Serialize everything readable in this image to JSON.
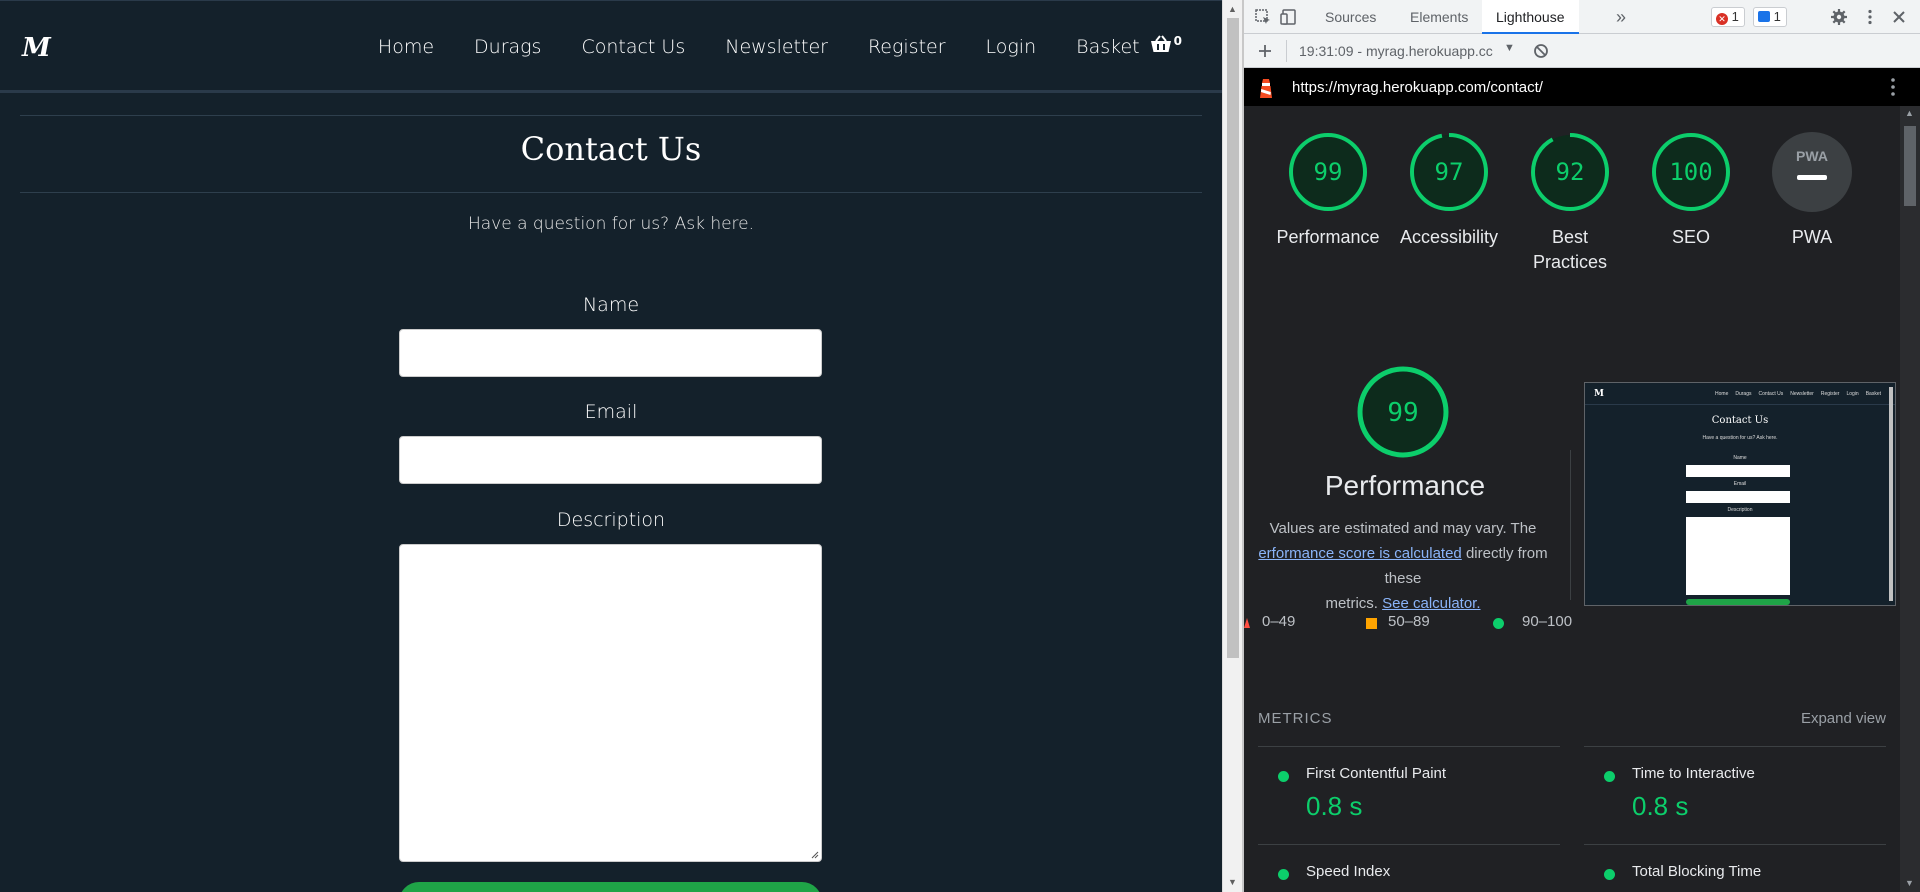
{
  "site": {
    "logo": "M",
    "nav": [
      "Home",
      "Durags",
      "Contact Us",
      "Newsletter",
      "Register",
      "Login",
      "Basket"
    ],
    "basket_count": "0",
    "title": "Contact Us",
    "subtitle": "Have a question for us? Ask here.",
    "fields": {
      "name_label": "Name",
      "email_label": "Email",
      "description_label": "Description"
    }
  },
  "devtools": {
    "tabs": [
      "Sources",
      "Elements",
      "Lighthouse"
    ],
    "active_tab": "Lighthouse",
    "more_tabs_glyph": "»",
    "error_count": "1",
    "message_count": "1",
    "report_selector": "19:31:09 - myrag.herokuapp.cc",
    "url": "https://myrag.herokuapp.com/contact/",
    "scores": [
      {
        "label": "Performance",
        "value": 99
      },
      {
        "label": "Accessibility",
        "value": 97
      },
      {
        "label": "Best Practices",
        "value": 92
      },
      {
        "label": "SEO",
        "value": 100
      },
      {
        "label": "PWA",
        "value": "PWA"
      }
    ],
    "performance": {
      "score": 99,
      "title": "Performance",
      "desc_line1": "Values are estimated and may vary. The",
      "link1": "erformance score is calculated",
      "desc_line2_rest": " directly from these",
      "desc_line3": "metrics. ",
      "link2": "See calculator.",
      "legend": [
        "0–49",
        "50–89",
        "90–100"
      ]
    },
    "thumbnail": {
      "nav": [
        "Home",
        "Durags",
        "Contact Us",
        "Newsletter",
        "Register",
        "Login",
        "Basket"
      ],
      "title": "Contact Us",
      "subtitle": "Have a question for us? Ask here.",
      "labels": [
        "Name",
        "Email",
        "Description"
      ]
    },
    "metrics_heading": "METRICS",
    "expand_label": "Expand view",
    "metrics": [
      {
        "name": "First Contentful Paint",
        "value": "0.8 s"
      },
      {
        "name": "Time to Interactive",
        "value": "0.8 s"
      },
      {
        "name": "Speed Index",
        "value": ""
      },
      {
        "name": "Total Blocking Time",
        "value": ""
      }
    ],
    "colors": {
      "pass": "#0cce6b",
      "average": "#ffa400",
      "fail": "#ff4e42",
      "pwa_gray": "#9aa0a6"
    }
  }
}
